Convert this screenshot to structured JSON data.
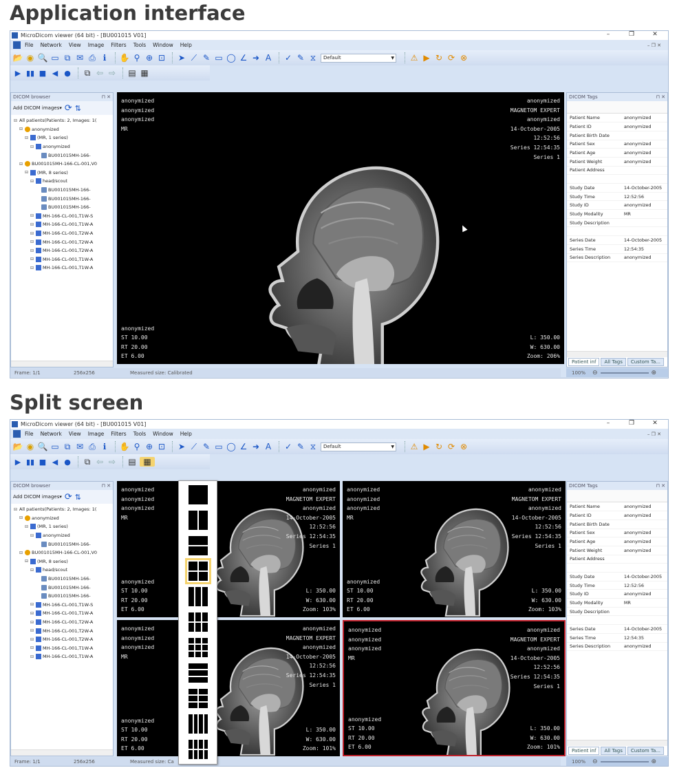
{
  "sections": {
    "app_title": "Application interface",
    "split_title": "Split screen"
  },
  "window": {
    "title": "MicroDicom viewer (64 bit) - [BU001015 V01]",
    "menu": [
      "File",
      "Network",
      "View",
      "Image",
      "Filters",
      "Tools",
      "Window",
      "Help"
    ],
    "preset_combo": "Default"
  },
  "browser": {
    "title": "DICOM browser",
    "add_label": "Add DICOM images",
    "tree": [
      {
        "level": 0,
        "type": "root",
        "label": "All patients(Patients: 2, Images: 1("
      },
      {
        "level": 1,
        "type": "patient",
        "label": "anonymized"
      },
      {
        "level": 2,
        "type": "series",
        "label": "(MR, 1 series)"
      },
      {
        "level": 3,
        "type": "series",
        "label": "anonymized"
      },
      {
        "level": 4,
        "type": "img",
        "label": "BU001015MH-166-"
      },
      {
        "level": 1,
        "type": "patient",
        "label": "BU001015MH-166-CL-001,V0"
      },
      {
        "level": 2,
        "type": "series",
        "label": "(MR, 8 series)"
      },
      {
        "level": 3,
        "type": "series",
        "label": "head/scout"
      },
      {
        "level": 4,
        "type": "img",
        "label": "BU001015MH-166-"
      },
      {
        "level": 4,
        "type": "img",
        "label": "BU001015MH-166-"
      },
      {
        "level": 4,
        "type": "img",
        "label": "BU001015MH-166-"
      },
      {
        "level": 3,
        "type": "series",
        "label": "MH-166-CL-001,T1W-S"
      },
      {
        "level": 3,
        "type": "series",
        "label": "MH-166-CL-001,T1W-A"
      },
      {
        "level": 3,
        "type": "series",
        "label": "MH-166-CL-001,T2W-A"
      },
      {
        "level": 3,
        "type": "series",
        "label": "MH-166-CL-001,T2W-A"
      },
      {
        "level": 3,
        "type": "series",
        "label": "MH-166-CL-001,T2W-A"
      },
      {
        "level": 3,
        "type": "series",
        "label": "MH-166-CL-001,T1W-A"
      },
      {
        "level": 3,
        "type": "series",
        "label": "MH-166-CL-001,T1W-A"
      }
    ]
  },
  "overlay": {
    "tl": [
      "anonymized",
      "anonymized",
      "anonymized",
      "MR"
    ],
    "tr": [
      "anonymized",
      "MAGNETOM EXPERT",
      "anonymized",
      "14-October-2005",
      "12:52:56",
      "Series 12:54:35",
      "Series 1"
    ],
    "bl": [
      "anonymized",
      "ST 10.00",
      "RT 20.00",
      "ET 6.00"
    ],
    "br_main": [
      "L: 350.00",
      "W: 630.00",
      "Zoom: 206%"
    ],
    "br_split_a": [
      "L: 350.00",
      "W: 630.00",
      "Zoom: 103%"
    ],
    "br_split_b": [
      "L: 350.00",
      "W: 630.00",
      "Zoom: 101%"
    ]
  },
  "tags": {
    "title": "DICOM Tags",
    "rows": [
      [
        "Patient Name",
        "anonymized"
      ],
      [
        "Patient ID",
        "anonymized"
      ],
      [
        "Patient Birth Date",
        ""
      ],
      [
        "Patient Sex",
        "anonymized"
      ],
      [
        "Patient Age",
        "anonymized"
      ],
      [
        "Patient Weight",
        "anonymized"
      ],
      [
        "Patient Address",
        ""
      ],
      [
        "",
        ""
      ],
      [
        "Study Date",
        "14-October-2005"
      ],
      [
        "Study Time",
        "12:52:56"
      ],
      [
        "Study ID",
        "anonymized"
      ],
      [
        "Study Modality",
        "MR"
      ],
      [
        "Study Description",
        ""
      ],
      [
        "",
        ""
      ],
      [
        "Series Date",
        "14-October-2005"
      ],
      [
        "Series Time",
        "12:54:35"
      ],
      [
        "Series Description",
        "anonymized"
      ]
    ],
    "tabs": [
      "Patient inf",
      "All Tags",
      "Custom Ta..."
    ]
  },
  "status": {
    "frame": "Frame: 1/1",
    "size": "256x256",
    "measured": "Measured size: Calibrated",
    "measured_short": "Measured size: Ca",
    "zoom": "100%"
  }
}
